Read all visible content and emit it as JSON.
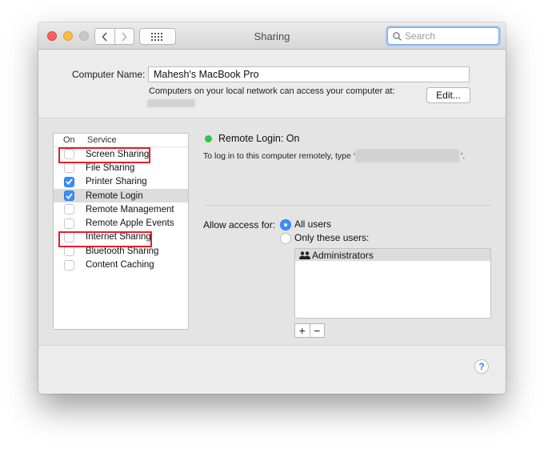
{
  "window": {
    "title": "Sharing",
    "search_placeholder": "Search"
  },
  "computer_name": {
    "label": "Computer Name:",
    "value": "Mahesh's MacBook Pro",
    "note": "Computers on your local network can access your computer at:",
    "edit_label": "Edit..."
  },
  "services": {
    "header_on": "On",
    "header_service": "Service",
    "items": [
      {
        "label": "Screen Sharing",
        "checked": false
      },
      {
        "label": "File Sharing",
        "checked": false
      },
      {
        "label": "Printer Sharing",
        "checked": true
      },
      {
        "label": "Remote Login",
        "checked": true
      },
      {
        "label": "Remote Management",
        "checked": false
      },
      {
        "label": "Remote Apple Events",
        "checked": false
      },
      {
        "label": "Internet Sharing",
        "checked": false
      },
      {
        "label": "Bluetooth Sharing",
        "checked": false
      },
      {
        "label": "Content Caching",
        "checked": false
      }
    ]
  },
  "detail": {
    "status": "Remote Login: On",
    "login_note": "To log in to this computer remotely, type ‘",
    "login_note_end": "’.",
    "allow_label": "Allow access for:",
    "option_all": "All users",
    "option_only": "Only these users:",
    "users": [
      "Administrators"
    ],
    "add_label": "+",
    "remove_label": "−"
  },
  "help_label": "?",
  "colors": {
    "accent": "#3b8efc",
    "status_green": "#28c840",
    "highlight_red": "#e2202a"
  }
}
